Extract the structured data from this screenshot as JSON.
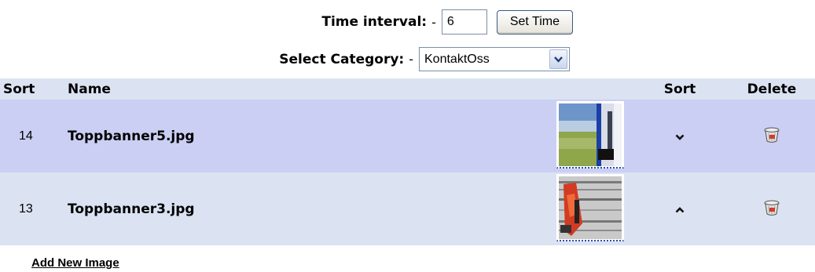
{
  "controls": {
    "time_label": "Time interval:",
    "time_dash": "-",
    "time_value": "6",
    "set_button": "Set Time",
    "category_label": "Select Category:",
    "category_dash": "-",
    "category_value": "KontaktOss"
  },
  "table": {
    "headers": {
      "sort": "Sort",
      "name": "Name",
      "sort2": "Sort",
      "delete": "Delete"
    },
    "rows": [
      {
        "sort": "14",
        "name": "Toppbanner5.jpg",
        "move": "down"
      },
      {
        "sort": "13",
        "name": "Toppbanner3.jpg",
        "move": "up"
      }
    ]
  },
  "footer": {
    "add_link": "Add New Image"
  },
  "icons": [
    "chevron-down-icon",
    "chevron-up-icon",
    "trash-icon",
    "dropdown-arrow-icon"
  ],
  "colors": {
    "row_a": "#cbcff4",
    "row_b": "#dbe3f2",
    "header": "#dbe3f2"
  }
}
